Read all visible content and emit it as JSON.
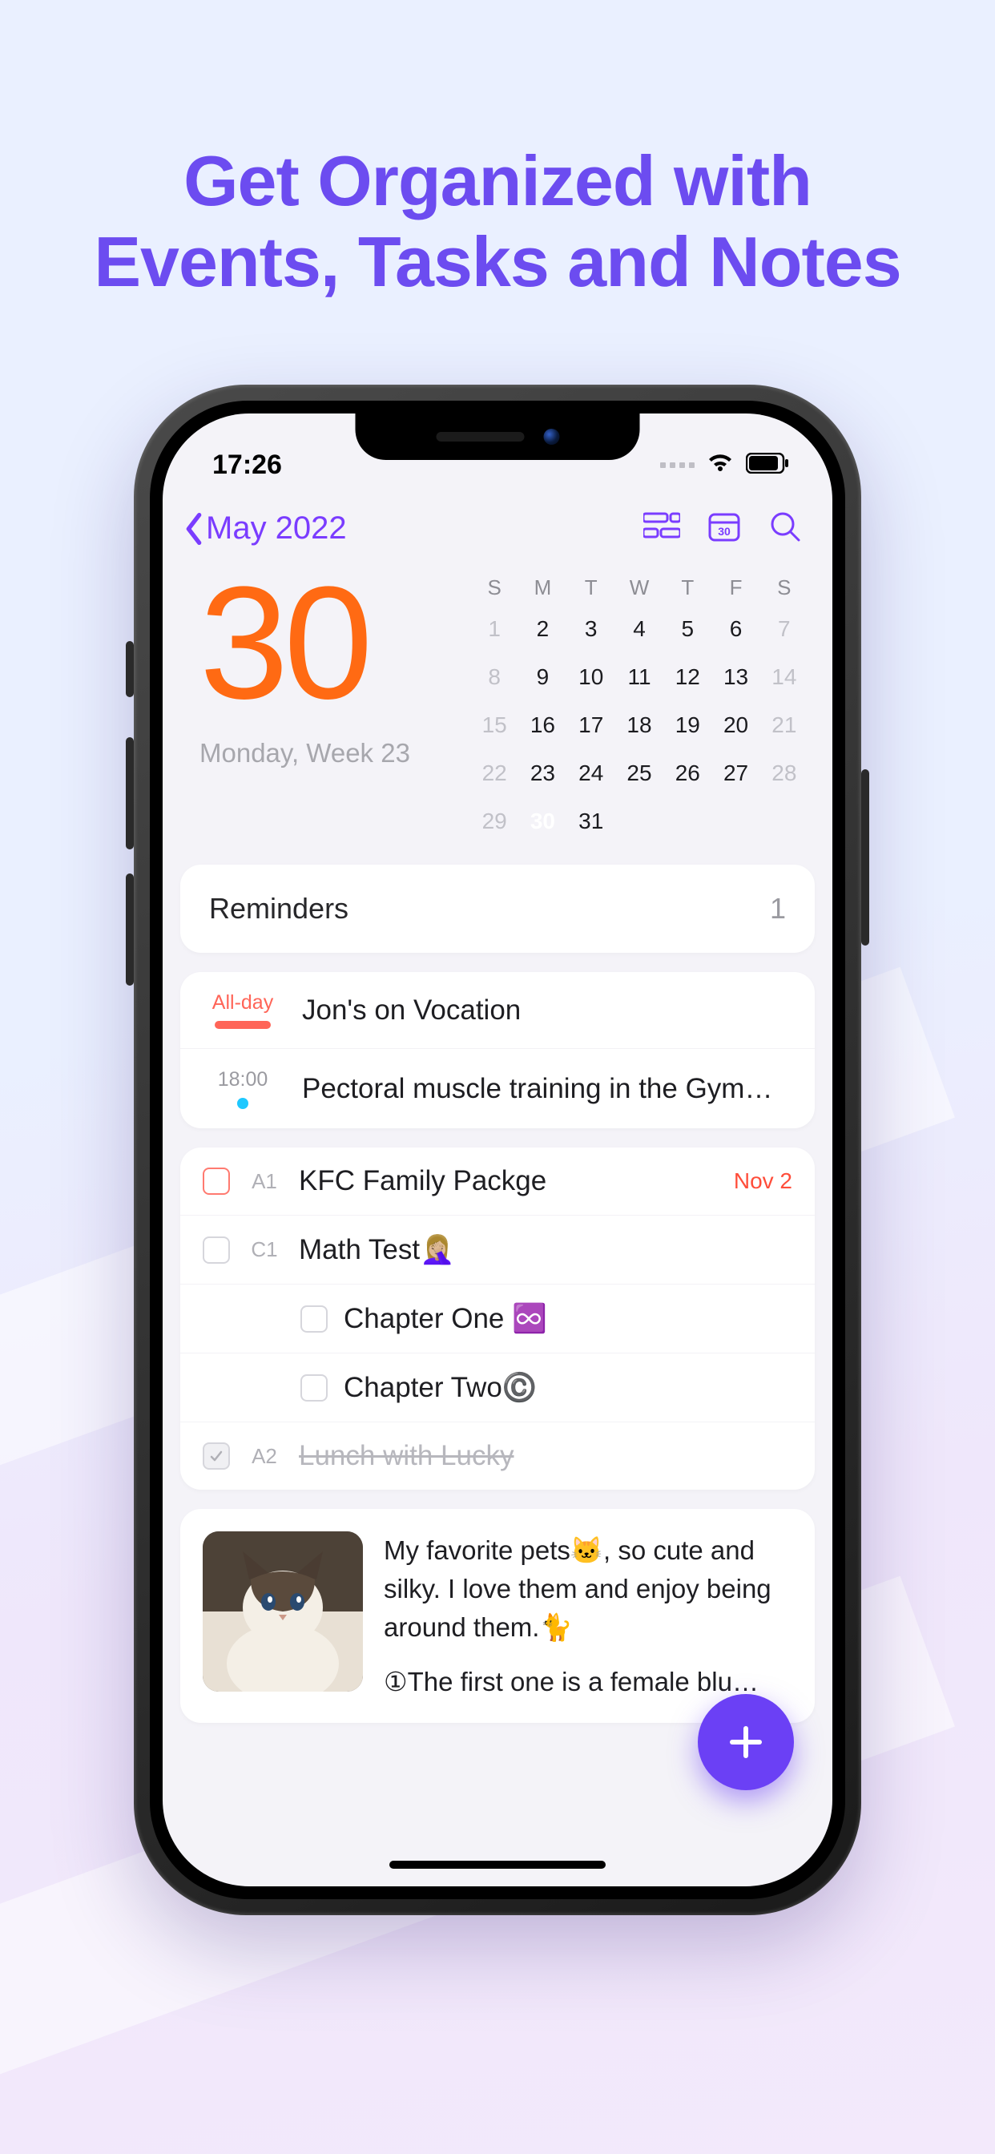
{
  "marketing": {
    "headline_l1": "Get Organized with",
    "headline_l2": "Events, Tasks and Notes"
  },
  "status": {
    "time": "17:26"
  },
  "nav": {
    "back_label": "May 2022"
  },
  "date": {
    "big": "30",
    "sub": "Monday, Week 23"
  },
  "calendar": {
    "dow": [
      "S",
      "M",
      "T",
      "W",
      "T",
      "F",
      "S"
    ],
    "rows": [
      [
        {
          "d": "1",
          "dim": true
        },
        {
          "d": "2"
        },
        {
          "d": "3"
        },
        {
          "d": "4"
        },
        {
          "d": "5"
        },
        {
          "d": "6"
        },
        {
          "d": "7",
          "dim": true
        }
      ],
      [
        {
          "d": "8",
          "dim": true
        },
        {
          "d": "9"
        },
        {
          "d": "10"
        },
        {
          "d": "11"
        },
        {
          "d": "12"
        },
        {
          "d": "13"
        },
        {
          "d": "14",
          "dim": true
        }
      ],
      [
        {
          "d": "15",
          "dim": true
        },
        {
          "d": "16"
        },
        {
          "d": "17"
        },
        {
          "d": "18"
        },
        {
          "d": "19"
        },
        {
          "d": "20"
        },
        {
          "d": "21",
          "dim": true
        }
      ],
      [
        {
          "d": "22",
          "dim": true
        },
        {
          "d": "23"
        },
        {
          "d": "24"
        },
        {
          "d": "25"
        },
        {
          "d": "26"
        },
        {
          "d": "27"
        },
        {
          "d": "28",
          "dim": true
        }
      ],
      [
        {
          "d": "29",
          "dim": true
        },
        {
          "d": "30",
          "sel": true
        },
        {
          "d": "31"
        },
        {
          "d": ""
        },
        {
          "d": ""
        },
        {
          "d": ""
        },
        {
          "d": ""
        }
      ]
    ]
  },
  "reminders": {
    "title": "Reminders",
    "count": "1"
  },
  "events": [
    {
      "time": "All-day",
      "title": "Jon's on Vocation",
      "kind": "allday"
    },
    {
      "time": "18:00",
      "title": "Pectoral muscle training in the Gym…",
      "kind": "timed"
    }
  ],
  "tasks": [
    {
      "prio": "A1",
      "title": "KFC Family Packge",
      "due": "Nov 2",
      "chk": "red"
    },
    {
      "prio": "C1",
      "title": "Math Test🤦🏼‍♀️",
      "chk": "plain"
    },
    {
      "prio": "",
      "title": "Chapter One ♾️",
      "chk": "plain",
      "indent": true
    },
    {
      "prio": "",
      "title": "Chapter Two©️",
      "chk": "plain",
      "indent": true
    },
    {
      "prio": "A2",
      "title": "Lunch with Lucky",
      "chk": "done",
      "strike": true
    }
  ],
  "note": {
    "body": "My favorite pets🐱, so cute and silky. I love them and enjoy being around them.🐈",
    "more": "①The first one is a female blu…"
  }
}
